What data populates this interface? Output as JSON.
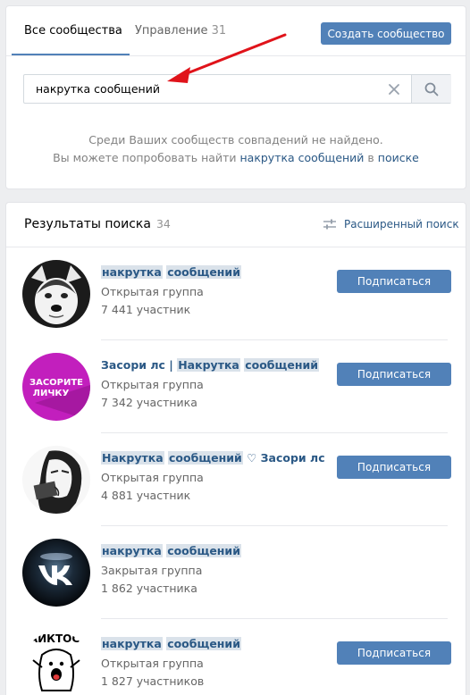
{
  "tabs": {
    "all_label": "Все сообщества",
    "manage_label": "Управление",
    "manage_count": "31"
  },
  "create_button": "Создать сообщество",
  "search": {
    "value": "накрутка сообщений"
  },
  "empty_message": {
    "line1": "Среди Ваших сообществ совпадений не найдено.",
    "line2_prefix": "Вы можете попробовать найти",
    "line2_link": "накрутка сообщений",
    "line2_middle": "в",
    "line2_link2": "поиске"
  },
  "results": {
    "title": "Результаты поиска",
    "count": "34",
    "advanced_search": "Расширенный поиск"
  },
  "groups": [
    {
      "name_parts": [
        "накрутка",
        "сообщений"
      ],
      "suffix": "",
      "type": "Открытая группа",
      "members": "7 441 участник",
      "button": "Подписаться",
      "has_button": true
    },
    {
      "name_prefix": "Засори лс | ",
      "name_parts": [
        "Накрутка",
        "сообщений"
      ],
      "suffix": "",
      "type": "Открытая группа",
      "members": "7 342 участника",
      "button": "Подписаться",
      "has_button": true,
      "avatar_text": [
        "ЗАСОРИТЕ",
        "ЛИЧКУ"
      ]
    },
    {
      "name_parts": [
        "Накрутка",
        "сообщений"
      ],
      "suffix": " ♡ Засори лс",
      "type": "Открытая группа",
      "members": "4 881 участник",
      "button": "Подписаться",
      "has_button": true
    },
    {
      "name_parts": [
        "накрутка",
        "сообщений"
      ],
      "suffix": "",
      "type": "Закрытая группа",
      "members": "1 862 участника",
      "button": "",
      "has_button": false
    },
    {
      "name_parts": [
        "накрутка",
        "сообщений"
      ],
      "suffix": "",
      "type": "Открытая группа",
      "members": "1 827 участников",
      "button": "Подписаться",
      "has_button": true,
      "avatar_text": [
        "АЙКТОС"
      ]
    }
  ],
  "colors": {
    "accent": "#5181b8",
    "link": "#2a5885",
    "arrow": "#e0131a"
  }
}
